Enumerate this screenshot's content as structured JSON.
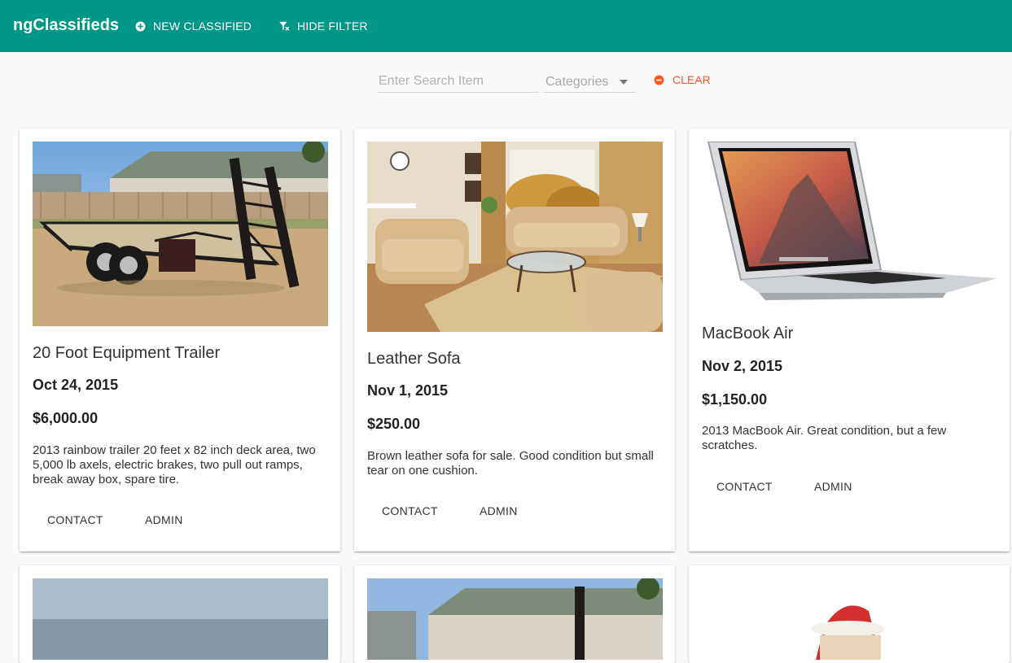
{
  "toolbar": {
    "brand": "ngClassifieds",
    "new_classified_label": "NEW CLASSIFIED",
    "hide_filter_label": "HIDE FILTER",
    "color": "#009688"
  },
  "filter": {
    "search_placeholder": "Enter Search Item",
    "categories_label": "Categories",
    "clear_label": "CLEAR",
    "clear_color": "#ff5722"
  },
  "icons": {
    "new_classified": "add-circle-icon",
    "hide_filter": "filter-clear-icon",
    "clear": "remove-circle-icon",
    "categories_caret": "dropdown-arrow-icon"
  },
  "classifieds": [
    {
      "title": "20 Foot Equipment Trailer",
      "date": "Oct 24, 2015",
      "price": "$6,000.00",
      "description": "2013 rainbow trailer 20 feet x 82 inch deck area, two 5,000 lb axels, electric brakes, two pull out ramps, break away box, spare tire.",
      "contact_label": "CONTACT",
      "admin_label": "ADMIN"
    },
    {
      "title": "Leather Sofa",
      "date": "Nov 1, 2015",
      "price": "$250.00",
      "description": "Brown leather sofa for sale. Good condition but small tear on one cushion.",
      "contact_label": "CONTACT",
      "admin_label": "ADMIN"
    },
    {
      "title": "MacBook Air",
      "date": "Nov 2, 2015",
      "price": "$1,150.00",
      "description": "2013 MacBook Air. Great condition, but a few scratches.",
      "contact_label": "CONTACT",
      "admin_label": "ADMIN"
    }
  ]
}
